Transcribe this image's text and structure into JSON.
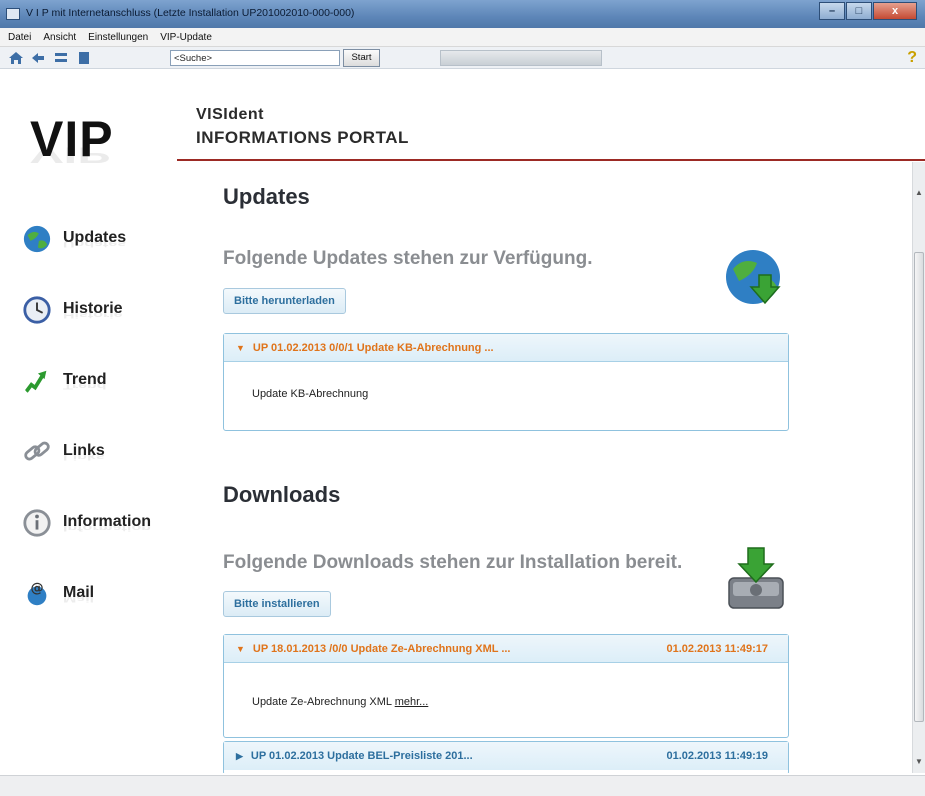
{
  "window": {
    "title": "V I P   mit Internetanschluss  (Letzte Installation UP201002010-000-000)",
    "buttons": {
      "minimize": "–",
      "maximize": "□",
      "close": "x"
    }
  },
  "menu": [
    "Datei",
    "Ansicht",
    "Einstellungen",
    "VIP-Update"
  ],
  "toolbar": {
    "search_value": "<Suche>",
    "start_label": "Start",
    "help_label": "?"
  },
  "sidebar": {
    "logo": "VIP",
    "items": [
      {
        "label": "Updates",
        "icon": "globe-icon"
      },
      {
        "label": "Historie",
        "icon": "clock-icon"
      },
      {
        "label": "Trend",
        "icon": "trend-arrow-icon"
      },
      {
        "label": "Links",
        "icon": "chain-link-icon"
      },
      {
        "label": "Information",
        "icon": "info-icon"
      },
      {
        "label": "Mail",
        "icon": "mail-icon"
      }
    ]
  },
  "header": {
    "line1": "VISIdent",
    "line2": "INFORMATIONS PORTAL"
  },
  "updates": {
    "title": "Updates",
    "subtitle": "Folgende Updates stehen zur Verfügung.",
    "button": "Bitte herunterladen",
    "items": [
      {
        "title": "UP 01.02.2013 0/0/1 Update KB-Abrechnung ...",
        "body": "Update KB-Abrechnung"
      }
    ]
  },
  "downloads": {
    "title": "Downloads",
    "subtitle": "Folgende Downloads stehen zur Installation bereit.",
    "button": "Bitte installieren",
    "items": [
      {
        "title": "UP 18.01.2013 /0/0 Update Ze-Abrechnung XML ...",
        "date": "01.02.2013 11:49:17",
        "body": "Update Ze-Abrechnung XML",
        "more": "mehr..."
      },
      {
        "title": "UP 01.02.2013 Update BEL-Preisliste 201...",
        "date": "01.02.2013 11:49:19"
      }
    ]
  },
  "colors": {
    "accent_red": "#9c2a24",
    "panel_orange": "#e0741b",
    "panel_blue": "#2d6f9e"
  }
}
